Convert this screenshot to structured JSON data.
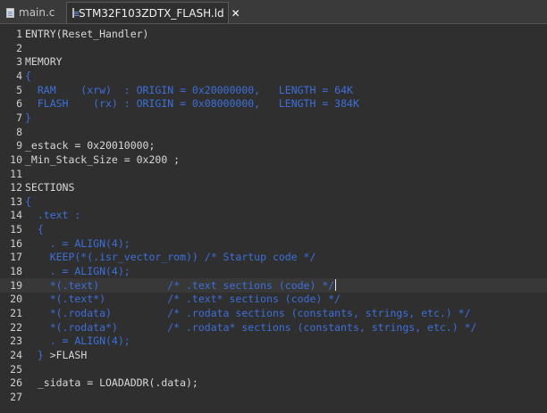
{
  "tabs": [
    {
      "label": "main.c",
      "active": false
    },
    {
      "label": "STM32F103ZDTX_FLASH.ld",
      "active": true,
      "close": "✕"
    }
  ],
  "editor": {
    "current_line": 19,
    "lines": [
      {
        "n": "1",
        "text": "ENTRY(Reset_Handler)",
        "style": "plain"
      },
      {
        "n": "2",
        "text": "",
        "style": "plain"
      },
      {
        "n": "3",
        "text": "MEMORY",
        "style": "plain"
      },
      {
        "n": "4",
        "text": "{",
        "style": "blue"
      },
      {
        "n": "5",
        "text": "  RAM    (xrw)  : ORIGIN = 0x20000000,   LENGTH = 64K",
        "style": "blue"
      },
      {
        "n": "6",
        "text": "  FLASH    (rx) : ORIGIN = 0x08000000,   LENGTH = 384K",
        "style": "blue"
      },
      {
        "n": "7",
        "text": "}",
        "style": "blue"
      },
      {
        "n": "8",
        "text": "",
        "style": "plain"
      },
      {
        "n": "9",
        "text": "_estack = 0x20010000;",
        "style": "plain"
      },
      {
        "n": "10",
        "text": "_Min_Stack_Size = 0x200 ;",
        "style": "plain"
      },
      {
        "n": "11",
        "text": "",
        "style": "plain"
      },
      {
        "n": "12",
        "text": "SECTIONS",
        "style": "plain"
      },
      {
        "n": "13",
        "text": "{",
        "style": "blue"
      },
      {
        "n": "14",
        "text": "  .text :",
        "style": "blue"
      },
      {
        "n": "15",
        "text": "  {",
        "style": "blue"
      },
      {
        "n": "16",
        "text": "    . = ALIGN(4);",
        "style": "blue"
      },
      {
        "n": "17",
        "text": "    KEEP(*(.isr_vector_rom)) /* Startup code */",
        "style": "blue"
      },
      {
        "n": "18",
        "text": "    . = ALIGN(4);",
        "style": "blue"
      },
      {
        "n": "19",
        "text": "    *(.text)           /* .text sections (code) */",
        "style": "blue"
      },
      {
        "n": "20",
        "text": "    *(.text*)          /* .text* sections (code) */",
        "style": "blue"
      },
      {
        "n": "21",
        "text": "    *(.rodata)         /* .rodata sections (constants, strings, etc.) */",
        "style": "blue"
      },
      {
        "n": "22",
        "text": "    *(.rodata*)        /* .rodata* sections (constants, strings, etc.) */",
        "style": "blue"
      },
      {
        "n": "23",
        "text": "    . = ALIGN(4);",
        "style": "blue"
      },
      {
        "n": "24",
        "text": "  } >FLASH",
        "style": "mixed"
      },
      {
        "n": "25",
        "text": "",
        "style": "plain"
      },
      {
        "n": "26",
        "text": "  _sidata = LOADADDR(.data);",
        "style": "plain"
      },
      {
        "n": "27",
        "text": "",
        "style": "plain"
      }
    ]
  },
  "colors": {
    "background": "#2f2f2f",
    "text": "#d8d8d8",
    "keyword_blue": "#3d6fd9",
    "current_line": "#383838"
  }
}
